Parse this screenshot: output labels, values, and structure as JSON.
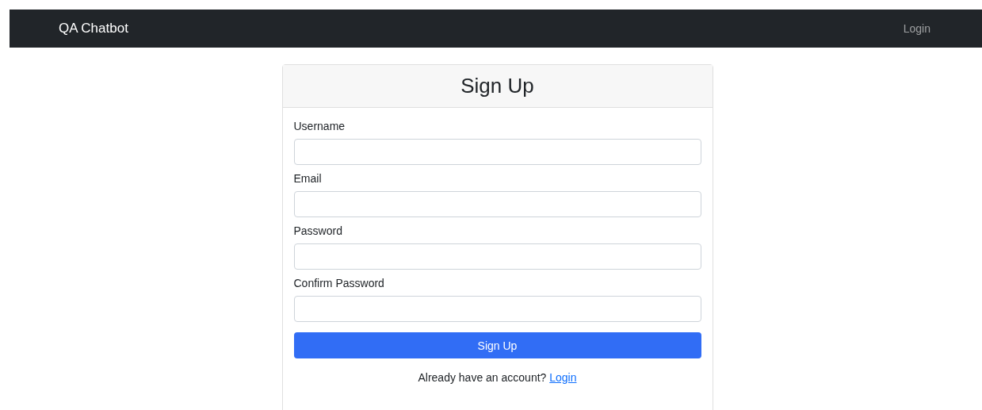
{
  "navbar": {
    "brand": "QA Chatbot",
    "links": [
      "Login"
    ]
  },
  "card": {
    "title": "Sign Up",
    "fields": [
      {
        "label": "Username"
      },
      {
        "label": "Email"
      },
      {
        "label": "Password"
      },
      {
        "label": "Confirm Password"
      }
    ],
    "submit": "Sign Up",
    "footer": {
      "text": "Already have an account?",
      "link": "Login"
    }
  }
}
